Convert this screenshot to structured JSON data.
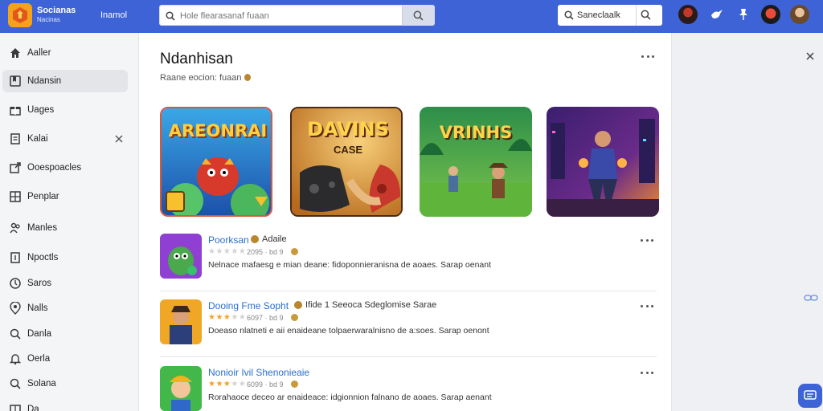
{
  "header": {
    "brand": "Socianas",
    "brand_sub": "Nacinas",
    "nav_link": "Inamol",
    "search_placeholder": "Hole flearasanaf fuaan",
    "search2_label": "Saneclaalk",
    "avatars": [
      "avatar-1",
      "avatar-2",
      "avatar-3"
    ],
    "icons": [
      "bird-icon",
      "pin-icon"
    ]
  },
  "sidebar": {
    "items": [
      {
        "label": "Aaller",
        "icon": "home-icon"
      },
      {
        "label": "Ndansin",
        "icon": "bookmark-icon",
        "active": true
      },
      {
        "label": "Uages",
        "icon": "gift-icon"
      },
      {
        "label": "Kalai",
        "icon": "note-icon",
        "closable": true
      },
      {
        "label": "Ooespoacles",
        "icon": "share-icon"
      },
      {
        "label": "Penplar",
        "icon": "grid-icon"
      },
      {
        "label": "Manles",
        "icon": "people-icon"
      },
      {
        "label": "Npoctls",
        "icon": "doc-icon"
      },
      {
        "label": "Saros",
        "icon": "clock-icon"
      },
      {
        "label": "Nalls",
        "icon": "location-icon"
      },
      {
        "label": "Danla",
        "icon": "search-icon"
      },
      {
        "label": "Oerla",
        "icon": "bell-icon"
      },
      {
        "label": "Solana",
        "icon": "magnifier-icon"
      },
      {
        "label": "Da",
        "icon": "book-icon"
      }
    ]
  },
  "main": {
    "title": "Ndanhisan",
    "subtitle": "Raane eocion: fuaan",
    "featured": [
      {
        "title": "AREONRAI",
        "name": "featured-game-1"
      },
      {
        "title": "DAVINS",
        "subtitle": "CASE",
        "name": "featured-game-2"
      },
      {
        "title": "VRINHS",
        "name": "featured-game-3"
      },
      {
        "title": "",
        "name": "featured-game-4"
      }
    ],
    "list": [
      {
        "title": "Poorksan",
        "title_meta": "Adaile",
        "stars": 0,
        "rating_meta": "2095 · bd 9",
        "desc": "Nelnace mafaesg e mian deane: fidoponnieranisna de aoaes. Sarap oenant"
      },
      {
        "title": "Dooing Fme Sopht",
        "title_meta": "Ifide 1 Seeoca Sdeglomise Sarae",
        "stars": 3,
        "rating_meta": "6097 · bd 9",
        "desc": "Doeaso nlatneti e aii enaideane tolpaerwaralnisno de a:soes. Sarap oenont"
      },
      {
        "title": "Nonioir Ivil Shenonieaie",
        "title_meta": "",
        "stars": 3,
        "rating_meta": "6099 · bd 9",
        "desc": "Rorahaoce deceo ar enaideace: idgionnion falnano de aoaes. Sarap aenant"
      }
    ]
  },
  "colors": {
    "accent": "#3d63d6",
    "link": "#2a6fce",
    "star": "#f1a325"
  }
}
